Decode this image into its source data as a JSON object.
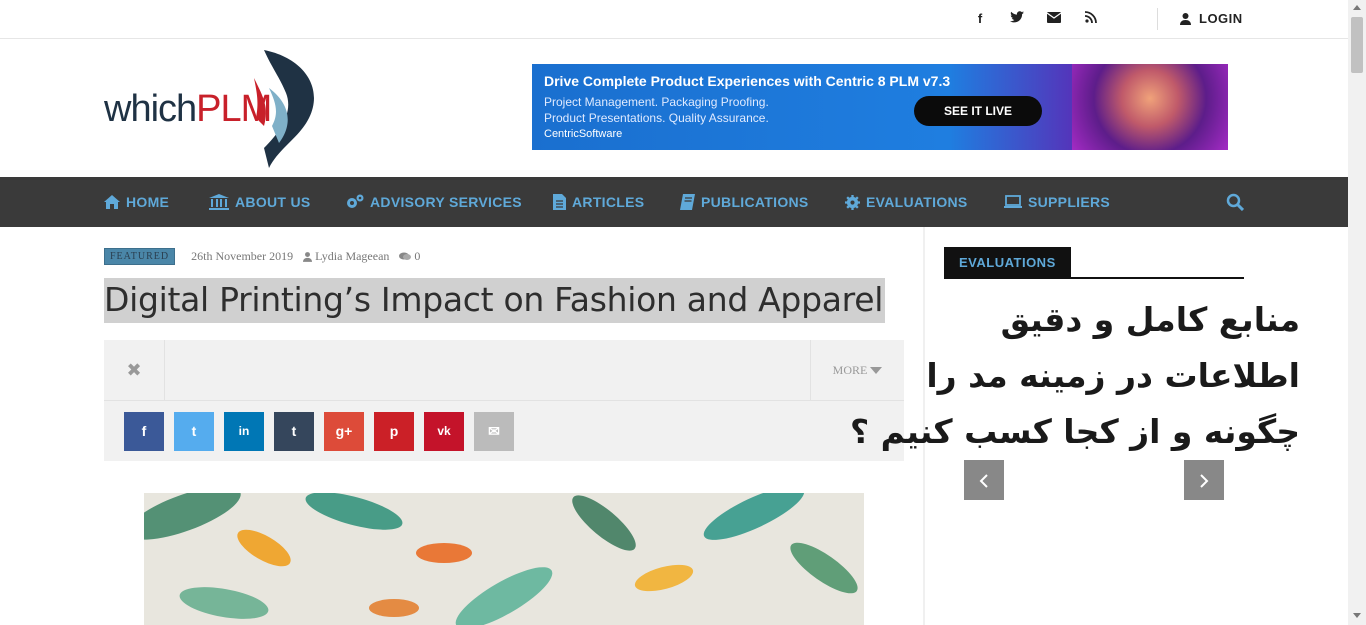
{
  "topbar": {
    "social_icons": [
      "facebook-icon",
      "twitter-icon",
      "email-icon",
      "rss-icon"
    ],
    "login_label": "LOGIN"
  },
  "logo": {
    "part1": "which",
    "part2": "PLM"
  },
  "ad": {
    "headline": "Drive Complete Product Experiences with Centric 8 PLM  v7.3",
    "sub1": "Project Management. Packaging Proofing.",
    "sub2": "Product Presentations. Quality Assurance.",
    "brand": "CentricSoftware",
    "cta": "SEE IT LIVE"
  },
  "nav": {
    "items": [
      {
        "label": "HOME",
        "icon": "home-icon"
      },
      {
        "label": "ABOUT US",
        "icon": "bank-icon"
      },
      {
        "label": "ADVISORY SERVICES",
        "icon": "gears-icon"
      },
      {
        "label": "ARTICLES",
        "icon": "document-icon"
      },
      {
        "label": "PUBLICATIONS",
        "icon": "book-icon"
      },
      {
        "label": "EVALUATIONS",
        "icon": "gear-icon"
      },
      {
        "label": "SUPPLIERS",
        "icon": "laptop-icon"
      }
    ]
  },
  "article": {
    "badge": "FEATURED",
    "date": "26th November 2019",
    "author": "Lydia Mageean",
    "comments": "0",
    "title": "Digital Printing’s Impact on Fashion and Apparel",
    "more_label": "MORE"
  },
  "share": {
    "buttons": [
      {
        "name": "facebook",
        "glyph": "f",
        "color": "#3b5998"
      },
      {
        "name": "twitter",
        "glyph": "t",
        "color": "#55acee"
      },
      {
        "name": "linkedin",
        "glyph": "in",
        "color": "#0077b5"
      },
      {
        "name": "tumblr",
        "glyph": "t",
        "color": "#35465c"
      },
      {
        "name": "googleplus",
        "glyph": "g+",
        "color": "#dd4b39"
      },
      {
        "name": "pinterest",
        "glyph": "p",
        "color": "#cb2027"
      },
      {
        "name": "vk",
        "glyph": "vk",
        "color": "#c4132a"
      },
      {
        "name": "email",
        "glyph": "✉",
        "color": "#bbbbbb"
      }
    ]
  },
  "sidebar": {
    "tab_label": "EVALUATIONS",
    "overlay_line1": "منابع کامل و دقیق",
    "overlay_line2": "اطلاعات در زمینه مد را",
    "overlay_line3": "چگونه و از کجا کسب کنیم ؟"
  }
}
